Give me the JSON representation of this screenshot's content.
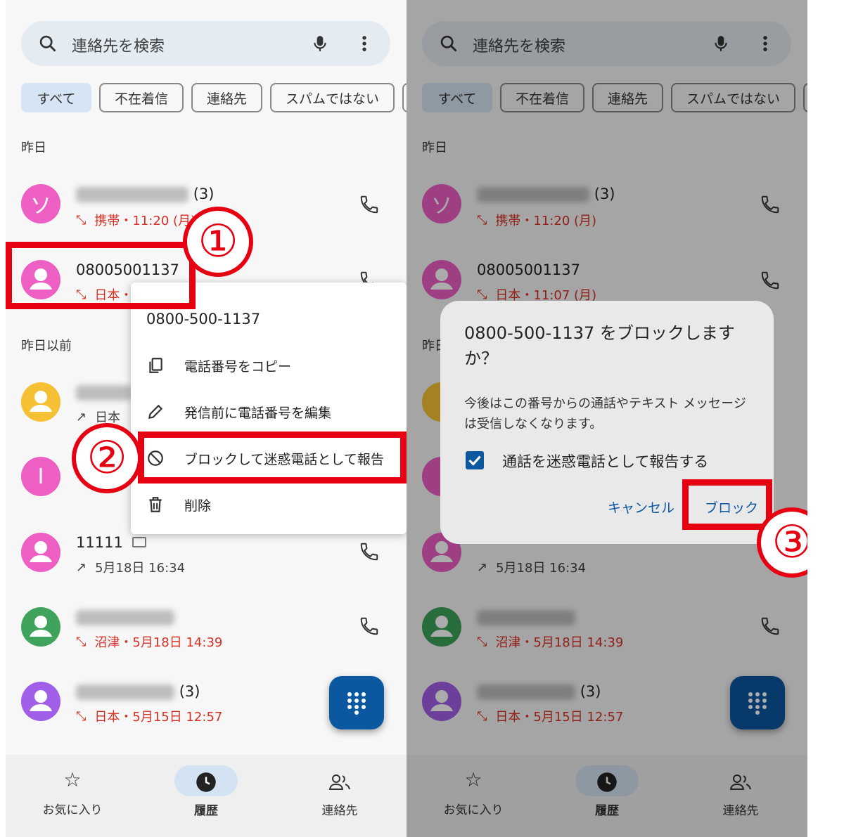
{
  "search": {
    "placeholder": "連絡先を検索"
  },
  "chips": [
    "すべて",
    "不在着信",
    "連絡先",
    "スパムではない"
  ],
  "sections": {
    "yesterday": "昨日",
    "earlier": "昨日以前"
  },
  "calls": [
    {
      "avatar": "ソ",
      "color": "#ee5fc4",
      "title_suffix": "(3)",
      "sub": "携帯・11:20 (月)",
      "missed": true
    },
    {
      "avatar": "",
      "color": "#ee5fc4",
      "title": "08005001137",
      "sub": "日本・11:07 (月)",
      "missed": true
    },
    {
      "avatar": "",
      "color": "#f5c033",
      "sub": "日本",
      "missed": false
    },
    {
      "avatar": "I",
      "color": "#ee5fc4",
      "missed": true
    },
    {
      "avatar": "",
      "color": "#ee5fc4",
      "title": "11111",
      "sub": "5月18日 16:34",
      "missed": false
    },
    {
      "avatar": "",
      "color": "#3fa35b",
      "sub": "沼津・5月18日 14:39",
      "missed": true
    },
    {
      "avatar": "",
      "color": "#a15ee8",
      "title_suffix": "(3)",
      "sub": "日本・5月15日 12:57",
      "missed": true
    }
  ],
  "menu": {
    "title": "0800-500-1137",
    "items": [
      "電話番号をコピー",
      "発信前に電話番号を編集",
      "ブロックして迷惑電話として報告",
      "削除"
    ]
  },
  "dialog": {
    "title": "0800-500-1137 をブロックしますか？",
    "body": "今後はこの番号からの通話やテキスト メッセージは受信しなくなります。",
    "checkbox_label": "通話を迷惑電話として報告する",
    "cancel": "キャンセル",
    "confirm": "ブロック"
  },
  "nav": [
    "お気に入り",
    "履歴",
    "連絡先"
  ],
  "steps": [
    "①",
    "②",
    "③"
  ],
  "colors": {
    "accent": "#0b57a0",
    "annotation": "#e60012",
    "missed": "#d93025"
  }
}
